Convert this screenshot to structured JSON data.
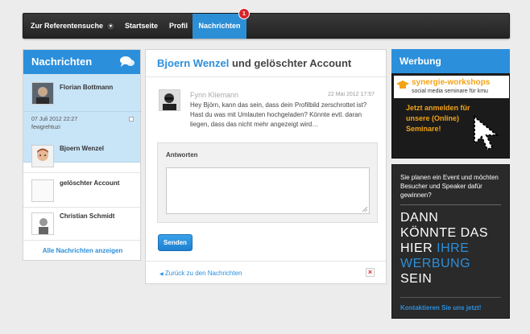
{
  "nav": {
    "items": [
      {
        "label": "Zur Referentensuche",
        "has_caret": true
      },
      {
        "label": "Startseite"
      },
      {
        "label": "Profil"
      },
      {
        "label": "Nachrichten",
        "active": true,
        "badge": "1"
      }
    ]
  },
  "left": {
    "title": "Nachrichten",
    "selected": {
      "name": "Florian Bottmann",
      "date": "07 Juli 2012 22:27",
      "subject": "fewgrehtuzi"
    },
    "items": [
      {
        "name": "Bjoern Wenzel"
      },
      {
        "name": "gelöschter Account"
      },
      {
        "name": "Christian Schmidt"
      }
    ],
    "show_all": "Alle Nachrichten anzeigen"
  },
  "conversation": {
    "title_name": "Bjoern Wenzel",
    "title_rest": " und gelöschter Account",
    "message": {
      "sender": "Fynn Kliemann",
      "date": "22 Mai 2012 17:57",
      "text": "Hey Björn, kann das sein, dass dein Profilbild zerschrottet ist? Hast du was mit Umlauten hochgeladen? Könnte evtl. daran liegen, dass das nicht mehr angezeigt wird…"
    },
    "reply_label": "Antworten",
    "send_label": "Senden",
    "back_label": "Zurück zu den Nachrichten"
  },
  "ads": {
    "title": "Werbung",
    "logo_name": "synergie-workshops",
    "logo_tagline": "social media seminare für kmu",
    "promo_text": "Jetzt anmelden für unsere (Online) Seminare!",
    "box_intro": "Sie planen ein Event und möchten Besucher und Speaker dafür gewinnen?",
    "big_line1": "DANN",
    "big_line2": "KÖNNTE DAS",
    "big_line3_a": "HIER ",
    "big_line3_b": "IHRE",
    "big_line4": "WERBUNG",
    "big_line5": "SEIN",
    "contact": "Kontaktieren Sie uns jetzt!"
  },
  "colors": {
    "accent": "#2b8fdc",
    "badge": "#d9232a",
    "promo": "#f3a316"
  }
}
